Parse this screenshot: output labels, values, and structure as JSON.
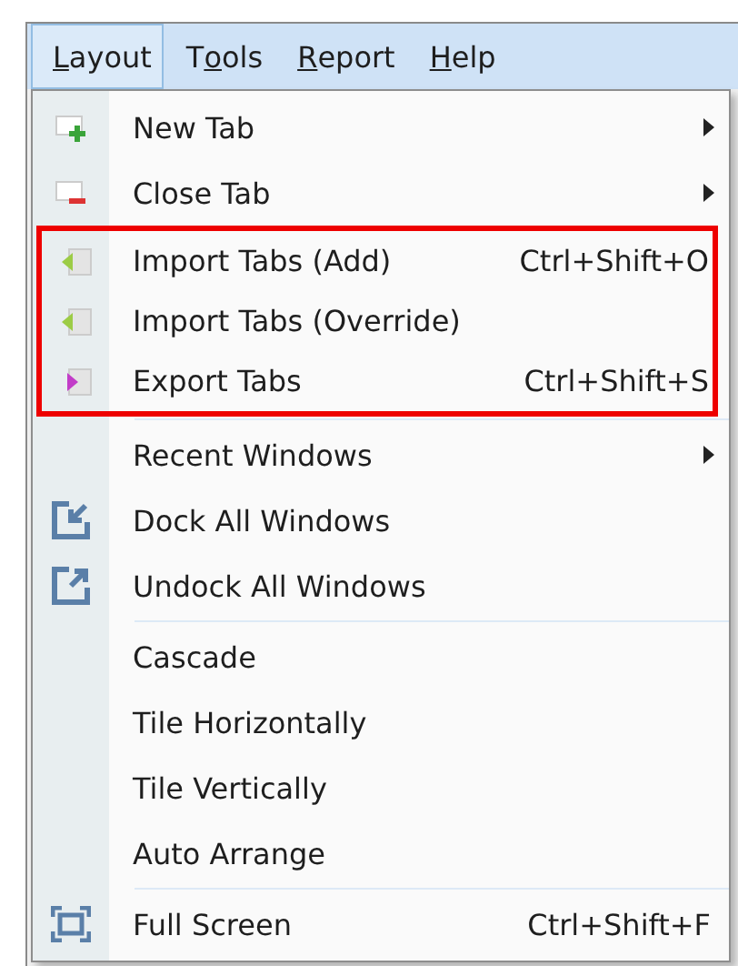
{
  "menubar": [
    {
      "key": "L",
      "post": "ayout",
      "selected": true
    },
    {
      "pre": "T",
      "key": "o",
      "post": "ols",
      "selected": false
    },
    {
      "key": "R",
      "post": "eport",
      "selected": false
    },
    {
      "key": "H",
      "post": "elp",
      "selected": false
    }
  ],
  "menu": {
    "sections": [
      {
        "separator_before": false,
        "highlighted": false,
        "items": [
          {
            "label": "New Tab",
            "kind": "tab-add",
            "submenu": true
          },
          {
            "label": "Close Tab",
            "kind": "tab-remove",
            "submenu": true
          }
        ]
      },
      {
        "separator_before": false,
        "highlighted": true,
        "items": [
          {
            "label": "Import Tabs (Add)",
            "kind": "import",
            "shortcut": "Ctrl+Shift+O"
          },
          {
            "label": "Import Tabs (Override)",
            "kind": "import"
          },
          {
            "label": "Export Tabs",
            "kind": "export",
            "shortcut": "Ctrl+Shift+S"
          }
        ]
      },
      {
        "separator_before": true,
        "highlighted": false,
        "items": [
          {
            "label": "Recent Windows",
            "kind": "plain",
            "submenu": true
          },
          {
            "label": "Dock All Windows",
            "kind": "dock"
          },
          {
            "label": "Undock All Windows",
            "kind": "undock"
          }
        ]
      },
      {
        "separator_before": true,
        "highlighted": false,
        "items": [
          {
            "label": "Cascade",
            "kind": "plain"
          },
          {
            "label": "Tile Horizontally",
            "kind": "plain"
          },
          {
            "label": "Tile Vertically",
            "kind": "plain"
          },
          {
            "label": "Auto Arrange",
            "kind": "plain"
          }
        ]
      },
      {
        "separator_before": true,
        "highlighted": false,
        "items": [
          {
            "label": "Full Screen",
            "kind": "fullscreen",
            "shortcut": "Ctrl+Shift+F"
          }
        ]
      }
    ]
  }
}
